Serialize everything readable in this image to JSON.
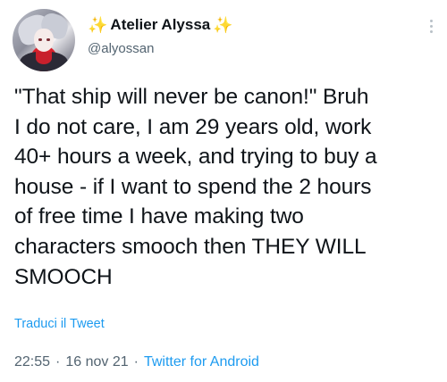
{
  "author": {
    "display_name": "Atelier Alyssa",
    "handle": "@alyossan",
    "name_emoji_left": "✨",
    "name_emoji_right": "✨"
  },
  "tweet": {
    "text": "\"That ship will never be canon!\" Bruh\nI do not care, I am 29 years old, work\n40+ hours a week, and trying to buy a\nhouse - if I want to spend the 2 hours\nof free time I have making two\ncharacters smooch then THEY WILL\nSMOOCH",
    "translate_label": "Traduci il Tweet",
    "time": "22:55",
    "separator": "·",
    "date": "16 nov 21",
    "source": "Twitter for Android"
  },
  "colors": {
    "link": "#1d9bf0",
    "secondary_text": "#536471",
    "primary_text": "#0f1419"
  },
  "icons": {
    "more": "more-options-icon",
    "avatar": "avatar"
  }
}
